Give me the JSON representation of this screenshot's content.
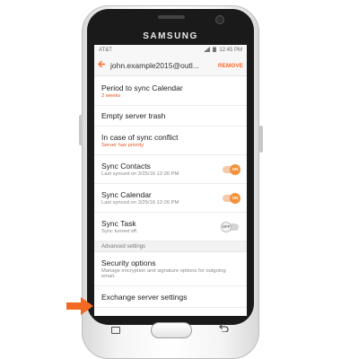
{
  "device": {
    "brand": "SAMSUNG"
  },
  "status_bar": {
    "carrier": "AT&T",
    "time": "12:45 PM"
  },
  "app_bar": {
    "back_icon": "back-arrow-icon",
    "account": "john.example2015@outl...",
    "remove_label": "REMOVE"
  },
  "settings": [
    {
      "title": "Period to sync Calendar",
      "subtitle": "2 weeks",
      "accent": true
    },
    {
      "title": "Empty server trash"
    },
    {
      "title": "In case of sync conflict",
      "subtitle": "Server has priority",
      "accent": true
    },
    {
      "title": "Sync Contacts",
      "subtitle": "Last synced on 3/25/16  12:26 PM",
      "toggle": "ON"
    },
    {
      "title": "Sync Calendar",
      "subtitle": "Last synced on 3/25/16  12:26 PM",
      "toggle": "ON"
    },
    {
      "title": "Sync Task",
      "subtitle": "Sync turned off.",
      "toggle": "OFF"
    }
  ],
  "advanced": {
    "header": "Advanced settings",
    "security": {
      "title": "Security options",
      "subtitle": "Manage encryption and signature options for outgoing email."
    },
    "exchange": {
      "title": "Exchange server settings"
    }
  },
  "colors": {
    "accent": "#FF6A2F",
    "toggle_on": "#F0923C",
    "arrow": "#F26A21"
  }
}
